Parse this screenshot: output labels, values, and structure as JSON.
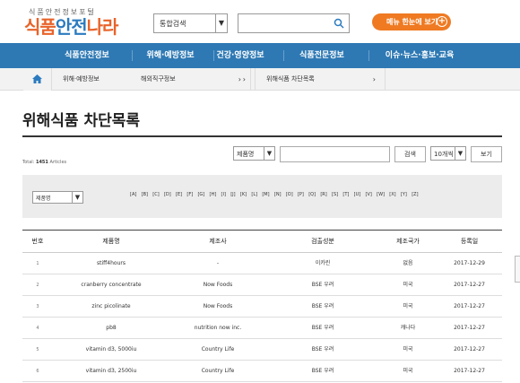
{
  "header": {
    "logo_sub": "식품안전정보포털",
    "logo_part1": "식품",
    "logo_part2": "안전",
    "logo_part3": "나라",
    "search_select": "통합검색",
    "menu_button": "메뉴 한눈에 보기",
    "menu_plus": "+"
  },
  "nav": {
    "items": [
      "식품안전정보",
      "위해·예방정보",
      "건강·영양정보",
      "식품전문정보",
      "이슈·뉴스·홍보·교육"
    ]
  },
  "breadcrumb": {
    "items": [
      "위해·예방정보",
      "해외직구정보",
      "위해식품 차단목록"
    ],
    "chevron": "›"
  },
  "page": {
    "title": "위해식품 차단목록"
  },
  "search": {
    "total_label": "Total:",
    "total_count": "1451",
    "total_unit": "Articles",
    "field_select": "제품명",
    "search_button": "검색",
    "per_page_select": "10개씩",
    "view_button": "보기"
  },
  "filter": {
    "select": "제품명",
    "letters": [
      "[A]",
      "[B]",
      "[C]",
      "[D]",
      "[E]",
      "[F]",
      "[G]",
      "[H]",
      "[I]",
      "[J]",
      "[K]",
      "[L]",
      "[M]",
      "[N]",
      "[O]",
      "[P]",
      "[Q]",
      "[R]",
      "[S]",
      "[T]",
      "[U]",
      "[V]",
      "[W]",
      "[X]",
      "[Y]",
      "[Z]"
    ]
  },
  "table": {
    "headers": [
      "번호",
      "제품명",
      "제조사",
      "검출성분",
      "제조국가",
      "등록일"
    ],
    "rows": [
      [
        "1",
        "stiff4hours",
        "-",
        "이카린",
        "없음",
        "2017-12-29"
      ],
      [
        "2",
        "cranberry concentrate",
        "Now Foods",
        "BSE 우려",
        "미국",
        "2017-12-27"
      ],
      [
        "3",
        "zinc picolinate",
        "Now Foods",
        "BSE 우려",
        "미국",
        "2017-12-27"
      ],
      [
        "4",
        "pb8",
        "nutrition now inc.",
        "BSE 우려",
        "캐나다",
        "2017-12-27"
      ],
      [
        "5",
        "vitamin d3, 5000iu",
        "Country Life",
        "BSE 우려",
        "미국",
        "2017-12-27"
      ],
      [
        "6",
        "vitamin d3, 2500iu",
        "Country Life",
        "BSE 우려",
        "미국",
        "2017-12-27"
      ]
    ]
  },
  "colors": {
    "nav_bg": "#2e79b4",
    "accent_orange": "#ef7a22",
    "logo_blue": "#2b7bbf"
  }
}
